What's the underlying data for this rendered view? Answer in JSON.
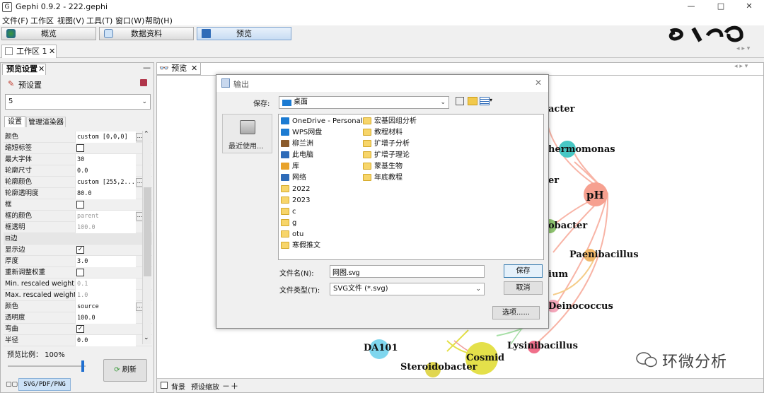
{
  "window": {
    "icon": "gephi-icon",
    "title": "Gephi 0.9.2 - 222.gephi",
    "controls": {
      "minimize": "—",
      "maximize": "□",
      "close": "✕"
    }
  },
  "menu": [
    "文件(F)",
    "工作区",
    "视图(V)",
    "工具(T)",
    "窗口(W)",
    "帮助(H)"
  ],
  "modes": {
    "overview": "概览",
    "data": "数据资料",
    "preview": "预览"
  },
  "workspace": {
    "tab": "工作区 1",
    "close": "✕"
  },
  "left_panel": {
    "tab": "预览设置",
    "minimize": "—",
    "preset_label": "预设置",
    "preset_value": "5",
    "subtabs": [
      "设置",
      "管理渲染器"
    ],
    "properties": [
      {
        "k": "颜色",
        "v": "custom [0,0,0]",
        "dots": true
      },
      {
        "k": "缩短标签",
        "chk": ""
      },
      {
        "k": "最大字体",
        "v": "30"
      },
      {
        "k": "轮廓尺寸",
        "v": "0.0"
      },
      {
        "k": "轮廓颜色",
        "v": "custom [255,2...",
        "dots": true
      },
      {
        "k": "轮廓透明度",
        "v": "80.0"
      },
      {
        "k": "框",
        "chk": ""
      },
      {
        "k": "框的颜色",
        "v": "parent",
        "dots": true,
        "dim": true
      },
      {
        "k": "框透明",
        "v": "100.0",
        "dim": true
      },
      {
        "k": "⊟边",
        "group": true
      },
      {
        "k": "显示边",
        "chk": "✓"
      },
      {
        "k": "厚度",
        "v": "3.0"
      },
      {
        "k": "重新调整权重",
        "chk": ""
      },
      {
        "k": "Min. rescaled weight",
        "v": "0.1",
        "dim": true
      },
      {
        "k": "Max. rescaled weight",
        "v": "1.0",
        "dim": true
      },
      {
        "k": "颜色",
        "v": "source",
        "dots": true
      },
      {
        "k": "透明度",
        "v": "100.0"
      },
      {
        "k": "弯曲",
        "chk": "✓"
      },
      {
        "k": "半径",
        "v": "0.0"
      }
    ],
    "ratio_label": "预览比例： 100%",
    "refresh": "刷新",
    "export": "SVG/PDF/PNG"
  },
  "right_panel": {
    "tab": "预览",
    "bottom_bg": "背景",
    "bottom_zoom": "预设缩放",
    "minus": "－",
    "plus": "＋"
  },
  "graph": {
    "nodes": [
      {
        "id": "pH",
        "label": "pH",
        "color": "#f6a090"
      },
      {
        "id": "thermomonas",
        "label": "hermomonas",
        "color": "#48c7c4"
      },
      {
        "id": "obacter",
        "label": "obacter",
        "color": "#8fc470"
      },
      {
        "id": "paenibacillus",
        "label": "Paenibacillus",
        "color": "#f1b86a"
      },
      {
        "id": "deinococcus",
        "label": "Deinococcus",
        "color": "#f4a6ba"
      },
      {
        "id": "ium",
        "label": "ium",
        "color": "#9ad6b0"
      },
      {
        "id": "acter",
        "label": "acter",
        "color": "#f6a090"
      },
      {
        "id": "er",
        "label": "er",
        "color": "#f6a090"
      },
      {
        "id": "da101",
        "label": "DA101",
        "color": "#7fd6ee"
      },
      {
        "id": "cosmid",
        "label": "Cosmid",
        "color": "#e4e04a"
      },
      {
        "id": "steroidobacter",
        "label": "Steroidobacter",
        "color": "#e0d650"
      },
      {
        "id": "lysinibacillus",
        "label": "Lysinibacillus",
        "color": "#f06f8a"
      }
    ]
  },
  "watermark": {
    "icon": "wechat-icon",
    "text": "环微分析"
  },
  "dialog": {
    "title": "输出",
    "close": "✕",
    "save_in_label": "保存:",
    "save_in_value": "桌面",
    "recent": "最近使用...",
    "files_col1": [
      "OneDrive - Personal",
      "WPS网盘",
      "柳兰洲",
      "此电脑",
      "库",
      "网络",
      "2022",
      "2023",
      "c",
      "g",
      "otu",
      "寒假推文"
    ],
    "files_col2": [
      "宏基因组分析",
      "教程材料",
      "扩增子分析",
      "扩增子理论",
      "蒙基生物",
      "年底教程"
    ],
    "filename_label": "文件名(N):",
    "filename_value": "网图.svg",
    "filetype_label": "文件类型(T):",
    "filetype_value": "SVG文件 (*.svg)",
    "save": "保存",
    "cancel": "取消",
    "options": "选项......"
  }
}
